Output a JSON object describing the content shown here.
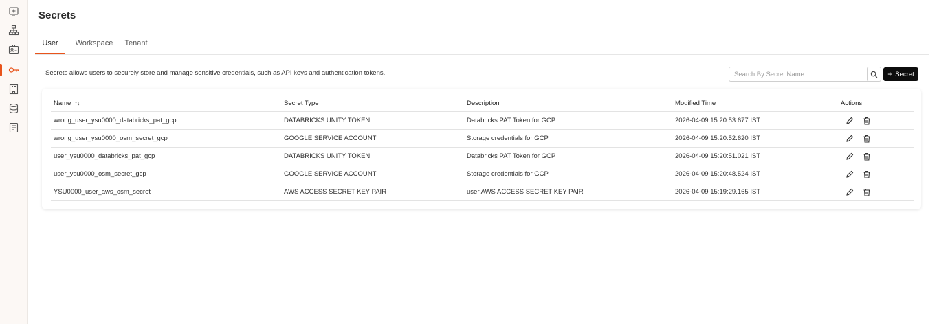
{
  "page": {
    "title": "Secrets",
    "description": "Secrets allows users to securely store and manage sensitive credentials, such as API keys and authentication tokens."
  },
  "tabs": [
    {
      "label": "User",
      "active": true
    },
    {
      "label": "Workspace",
      "active": false
    },
    {
      "label": "Tenant",
      "active": false
    }
  ],
  "search": {
    "placeholder": "Search By Secret Name"
  },
  "add_button": {
    "label": "Secret"
  },
  "sidebar": {
    "items": [
      {
        "icon": "monitor-plus-icon"
      },
      {
        "icon": "hierarchy-icon"
      },
      {
        "icon": "id-card-icon"
      },
      {
        "icon": "key-icon",
        "active": true
      },
      {
        "icon": "building-icon"
      },
      {
        "icon": "database-icon"
      },
      {
        "icon": "document-list-icon"
      }
    ]
  },
  "table": {
    "headers": {
      "name": "Name",
      "type": "Secret Type",
      "description": "Description",
      "modified": "Modified Time",
      "actions": "Actions"
    },
    "rows": [
      {
        "name": "wrong_user_ysu0000_databricks_pat_gcp",
        "type": "DATABRICKS UNITY TOKEN",
        "description": "Databricks PAT Token for GCP",
        "modified": "2026-04-09 15:20:53.677 IST"
      },
      {
        "name": "wrong_user_ysu0000_osm_secret_gcp",
        "type": "GOOGLE SERVICE ACCOUNT",
        "description": "Storage credentials for GCP",
        "modified": "2026-04-09 15:20:52.620 IST"
      },
      {
        "name": "user_ysu0000_databricks_pat_gcp",
        "type": "DATABRICKS UNITY TOKEN",
        "description": "Databricks PAT Token for GCP",
        "modified": "2026-04-09 15:20:51.021 IST"
      },
      {
        "name": "user_ysu0000_osm_secret_gcp",
        "type": "GOOGLE SERVICE ACCOUNT",
        "description": "Storage credentials for GCP",
        "modified": "2026-04-09 15:20:48.524 IST"
      },
      {
        "name": "YSU0000_user_aws_osm_secret",
        "type": "AWS ACCESS SECRET KEY PAIR",
        "description": "user AWS ACCESS SECRET KEY PAIR",
        "modified": "2026-04-09 15:19:29.165 IST"
      }
    ]
  },
  "colors": {
    "accent": "#e8541c",
    "sidebar_bg": "#fcf8f5",
    "button_bg": "#0d0d0d"
  }
}
